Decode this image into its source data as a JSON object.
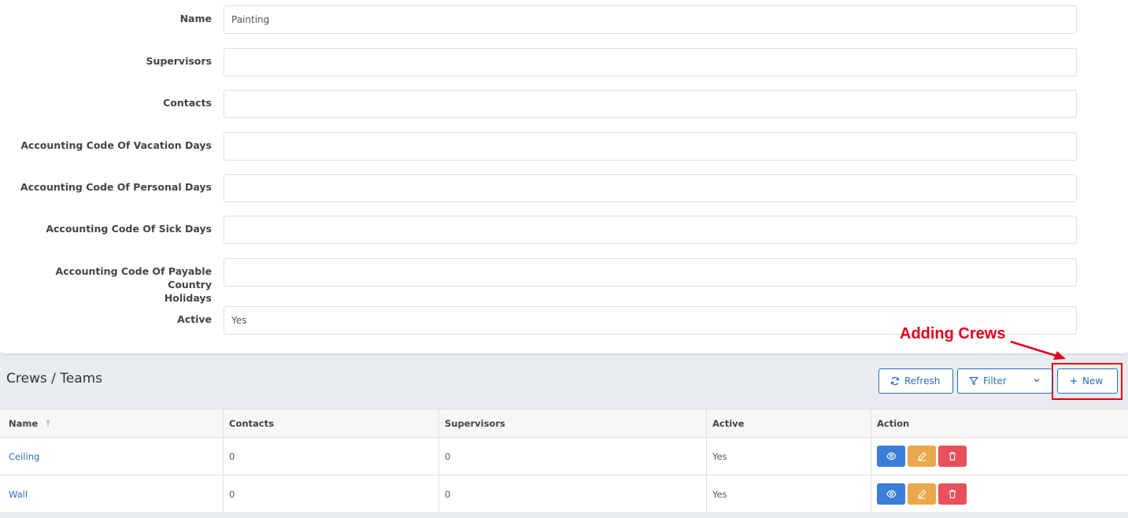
{
  "form": {
    "fields": [
      {
        "label": "Name",
        "value": "Painting"
      },
      {
        "label": "Supervisors",
        "value": ""
      },
      {
        "label": "Contacts",
        "value": ""
      },
      {
        "label": "Accounting Code Of Vacation Days",
        "value": ""
      },
      {
        "label": "Accounting Code Of Personal Days",
        "value": ""
      },
      {
        "label": "Accounting Code Of Sick Days",
        "value": ""
      },
      {
        "label_line1": "Accounting Code Of Payable Country",
        "label_line2": "Holidays",
        "value": ""
      },
      {
        "label": "Active",
        "value": "Yes"
      }
    ]
  },
  "annotation": {
    "text": "Adding Crews",
    "color": "#e2001a"
  },
  "crews": {
    "title": "Crews / Teams",
    "toolbar": {
      "refresh_label": "Refresh",
      "filter_label": "Filter",
      "new_label": "New"
    },
    "columns": [
      "Name",
      "Contacts",
      "Supervisors",
      "Active",
      "Action"
    ],
    "rows": [
      {
        "name": "Ceiling",
        "contacts": "0",
        "supervisors": "0",
        "active": "Yes"
      },
      {
        "name": "Wall",
        "contacts": "0",
        "supervisors": "0",
        "active": "Yes"
      }
    ],
    "row_actions": [
      "eye-icon",
      "pencil-icon",
      "trash-icon"
    ]
  },
  "colors": {
    "accent": "#2c6fbb",
    "view": "#3b7dd8",
    "edit": "#e9a84b",
    "delete": "#e8505b"
  }
}
